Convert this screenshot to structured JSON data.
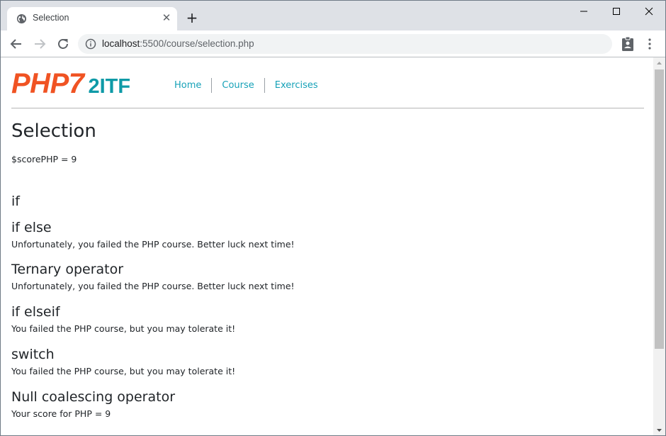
{
  "browser": {
    "tab_title": "Selection",
    "url_host": "localhost",
    "url_rest": ":5500/course/selection.php",
    "icons": {
      "favicon": "globe-icon",
      "tab_close": "close-icon",
      "new_tab": "plus-icon",
      "back": "arrow-left-icon",
      "forward": "arrow-right-icon",
      "reload": "reload-icon",
      "site_info": "info-icon",
      "extension": "clipboard-user-icon",
      "menu": "kebab-menu-icon",
      "minimize": "minimize-icon",
      "maximize": "maximize-icon",
      "close_window": "close-icon"
    },
    "tab_close_glyph": "✕",
    "new_tab_glyph": "+"
  },
  "site": {
    "logo_main": "PHP7",
    "logo_sub": "2ITF",
    "colors": {
      "logo_main": "#f05323",
      "logo_sub": "#0e9aa7",
      "nav_link": "#17a2b8"
    },
    "nav": [
      {
        "label": "Home"
      },
      {
        "label": "Course"
      },
      {
        "label": "Exercises"
      }
    ]
  },
  "main": {
    "title": "Selection",
    "intro": "$scorePHP = 9",
    "sections": [
      {
        "heading": "if",
        "text": ""
      },
      {
        "heading": "if else",
        "text": "Unfortunately, you failed the PHP course. Better luck next time!"
      },
      {
        "heading": "Ternary operator",
        "text": "Unfortunately, you failed the PHP course. Better luck next time!"
      },
      {
        "heading": "if elseif",
        "text": "You failed the PHP course, but you may tolerate it!"
      },
      {
        "heading": "switch",
        "text": "You failed the PHP course, but you may tolerate it!"
      },
      {
        "heading": "Null coalescing operator",
        "text": "Your score for PHP = 9"
      }
    ]
  }
}
